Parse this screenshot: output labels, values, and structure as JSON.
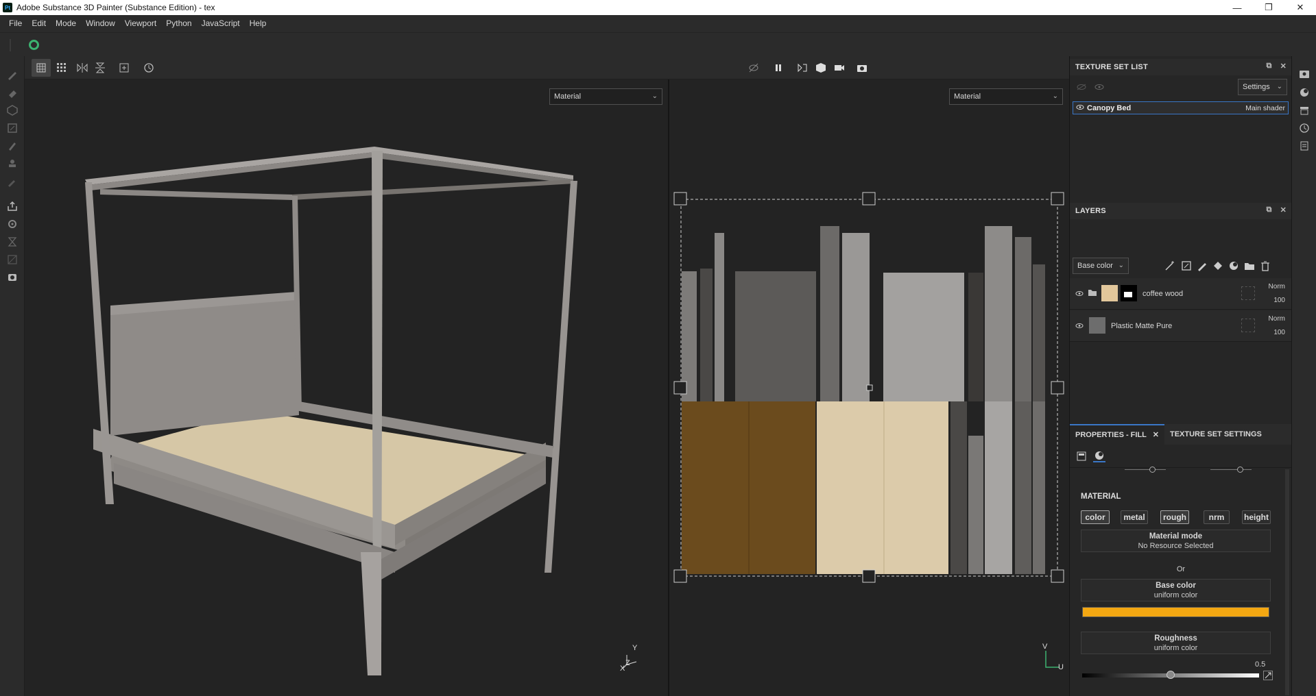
{
  "window": {
    "app_icon": "Pt",
    "title": "Adobe Substance 3D Painter (Substance Edition) - tex",
    "minimize": "—",
    "restore": "❐",
    "close": "✕"
  },
  "menu": [
    "File",
    "Edit",
    "Mode",
    "Window",
    "Viewport",
    "Python",
    "JavaScript",
    "Help"
  ],
  "viewport3d": {
    "mode_label": "Material",
    "axis_x": "X",
    "axis_y": "Y",
    "axis_z": "Z"
  },
  "viewport2d": {
    "mode_label": "Material",
    "axis_u": "U",
    "axis_v": "V"
  },
  "texture_set_list": {
    "title": "TEXTURE SET LIST",
    "settings_label": "Settings",
    "item": {
      "name": "Canopy Bed",
      "shader": "Main shader"
    }
  },
  "layers": {
    "title": "LAYERS",
    "channel_select": "Base color",
    "items": [
      {
        "name": "coffee wood",
        "blend": "Norm",
        "opacity": "100"
      },
      {
        "name": "Plastic Matte Pure",
        "blend": "Norm",
        "opacity": "100"
      }
    ]
  },
  "properties": {
    "tab_fill": "PROPERTIES - FILL",
    "tab_texture_settings": "TEXTURE SET SETTINGS",
    "section_title": "MATERIAL",
    "channels": [
      "color",
      "metal",
      "rough",
      "nrm",
      "height"
    ],
    "material_mode": {
      "title": "Material mode",
      "value": "No Resource Selected"
    },
    "or_label": "Or",
    "base_color": {
      "title": "Base color",
      "value": "uniform color",
      "swatch": "#f3a712"
    },
    "roughness": {
      "title": "Roughness",
      "value": "uniform color",
      "amount": "0.5",
      "fraction": 0.5
    }
  },
  "colors": {
    "accent": "#3a77c7",
    "panel": "#262626",
    "wood_light": "#d9c8a4",
    "wood_dark": "#6b4b1d"
  }
}
